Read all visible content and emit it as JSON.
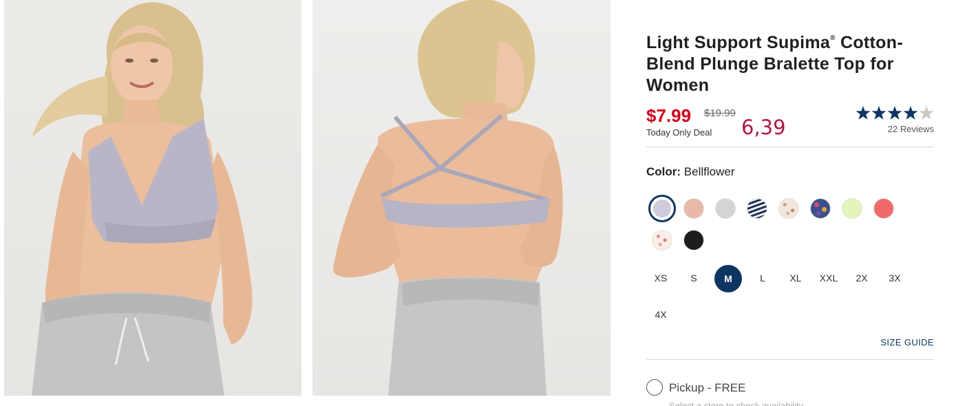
{
  "product": {
    "title_part1": "Light Support Supima",
    "title_reg": "®",
    "title_part2": " Cotton-Blend Plunge Bralette Top for Women"
  },
  "pricing": {
    "current": "$7.99",
    "original": "$19.99",
    "deal_label": "Today Only Deal",
    "converted": "6,39"
  },
  "rating": {
    "stars": 4,
    "max": 5,
    "reviews_label": "22 Reviews"
  },
  "color": {
    "label": "Color:",
    "selected": "Bellflower",
    "swatches": [
      {
        "color": "#cfcbdc"
      },
      {
        "color": "#e8b9a9"
      },
      {
        "color": "#d4d4d4"
      },
      {
        "color": "stripe-navy"
      },
      {
        "color": "floral-beige"
      },
      {
        "color": "floral-multi"
      },
      {
        "color": "#e4f5bb"
      },
      {
        "color": "#f06a6a"
      },
      {
        "color": "floral-pink"
      },
      {
        "color": "#1d1d1f"
      }
    ]
  },
  "sizes": {
    "options": [
      "XS",
      "S",
      "M",
      "L",
      "XL",
      "XXL",
      "2X",
      "3X",
      "4X"
    ],
    "selected": "M",
    "guide_label": "SIZE GUIDE"
  },
  "fulfillment": {
    "pickup_label": "Pickup - FREE",
    "pickup_subtext": "Select a store to check availability"
  },
  "colors": {
    "accent_navy": "#0e3562",
    "sale_red": "#d0021b",
    "converted_price": "#b0173f"
  }
}
